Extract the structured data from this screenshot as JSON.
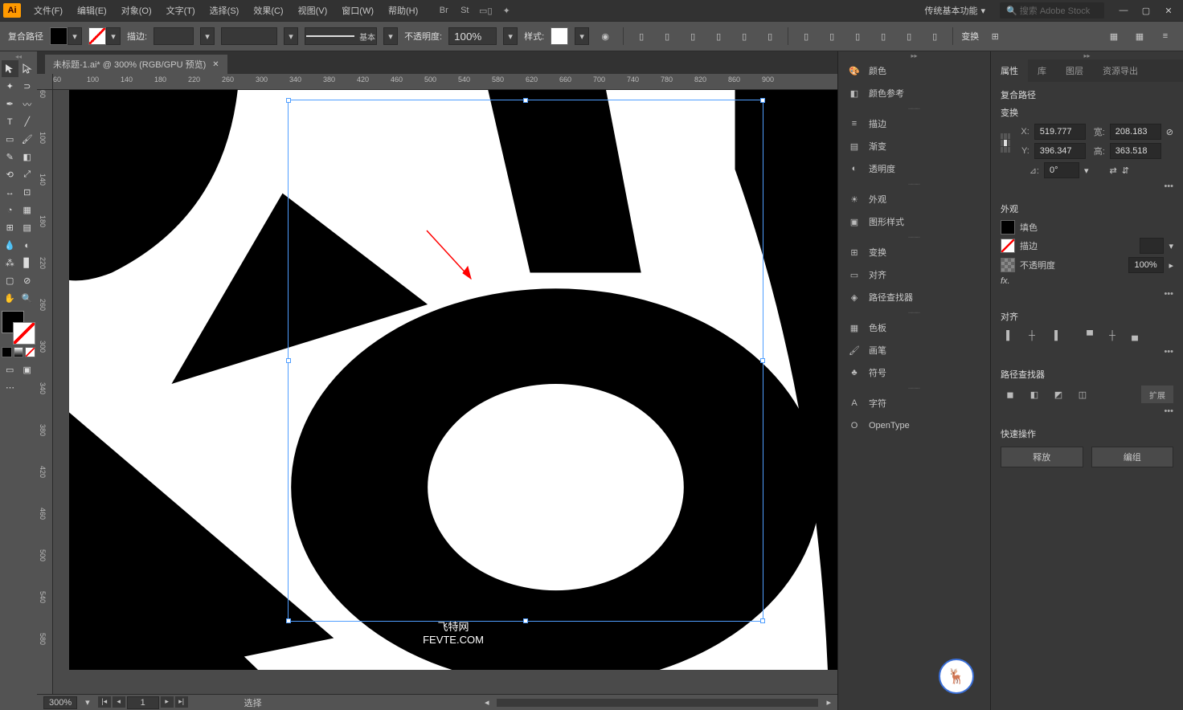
{
  "app": {
    "logo": "Ai"
  },
  "menu": [
    "文件(F)",
    "编辑(E)",
    "对象(O)",
    "文字(T)",
    "选择(S)",
    "效果(C)",
    "视图(V)",
    "窗口(W)",
    "帮助(H)"
  ],
  "workspace": "传统基本功能",
  "search_placeholder": "搜索 Adobe Stock",
  "control": {
    "selection": "复合路径",
    "stroke_label": "描边:",
    "stroke_weight": "",
    "profile_label": "基本",
    "opacity_label": "不透明度:",
    "opacity_value": "100%",
    "style_label": "样式:",
    "transform_label": "变换"
  },
  "document": {
    "tab": "未标题-1.ai* @ 300% (RGB/GPU 预览)"
  },
  "ruler_h": [
    60,
    100,
    140,
    180,
    220,
    260,
    300,
    340,
    380,
    420,
    460,
    500,
    540,
    580,
    620,
    660,
    700,
    740,
    780,
    820,
    860,
    900
  ],
  "ruler_v": [
    60,
    100,
    140,
    180,
    220,
    260,
    300,
    340,
    380,
    420,
    460,
    500,
    540,
    580
  ],
  "panel_groups": [
    [
      "颜色",
      "颜色参考"
    ],
    [
      "描边",
      "渐变",
      "透明度"
    ],
    [
      "外观",
      "图形样式"
    ],
    [
      "变换",
      "对齐",
      "路径查找器"
    ],
    [
      "色板",
      "画笔",
      "符号"
    ],
    [
      "字符",
      "OpenType"
    ]
  ],
  "props": {
    "tabs": [
      "属性",
      "库",
      "图层",
      "资源导出"
    ],
    "selection_type": "复合路径",
    "transform": {
      "title": "变换",
      "x_label": "X:",
      "x": "519.777",
      "y_label": "Y:",
      "y": "396.347",
      "w_label": "宽:",
      "w": "208.183",
      "h_label": "高:",
      "h": "363.518",
      "angle_label": "⊿:",
      "angle": "0°"
    },
    "appearance": {
      "title": "外观",
      "fill_label": "填色",
      "stroke_label": "描边",
      "opacity_label": "不透明度",
      "opacity_value": "100%",
      "fx_label": "fx."
    },
    "align": {
      "title": "对齐"
    },
    "pathfinder": {
      "title": "路径查找器",
      "expand": "扩展"
    },
    "quick": {
      "title": "快速操作",
      "release": "释放",
      "group": "编组"
    }
  },
  "status": {
    "zoom": "300%",
    "artboard": "1",
    "tool": "选择"
  },
  "watermark": {
    "line1": "飞特网",
    "line2": "FEVTE.COM"
  }
}
